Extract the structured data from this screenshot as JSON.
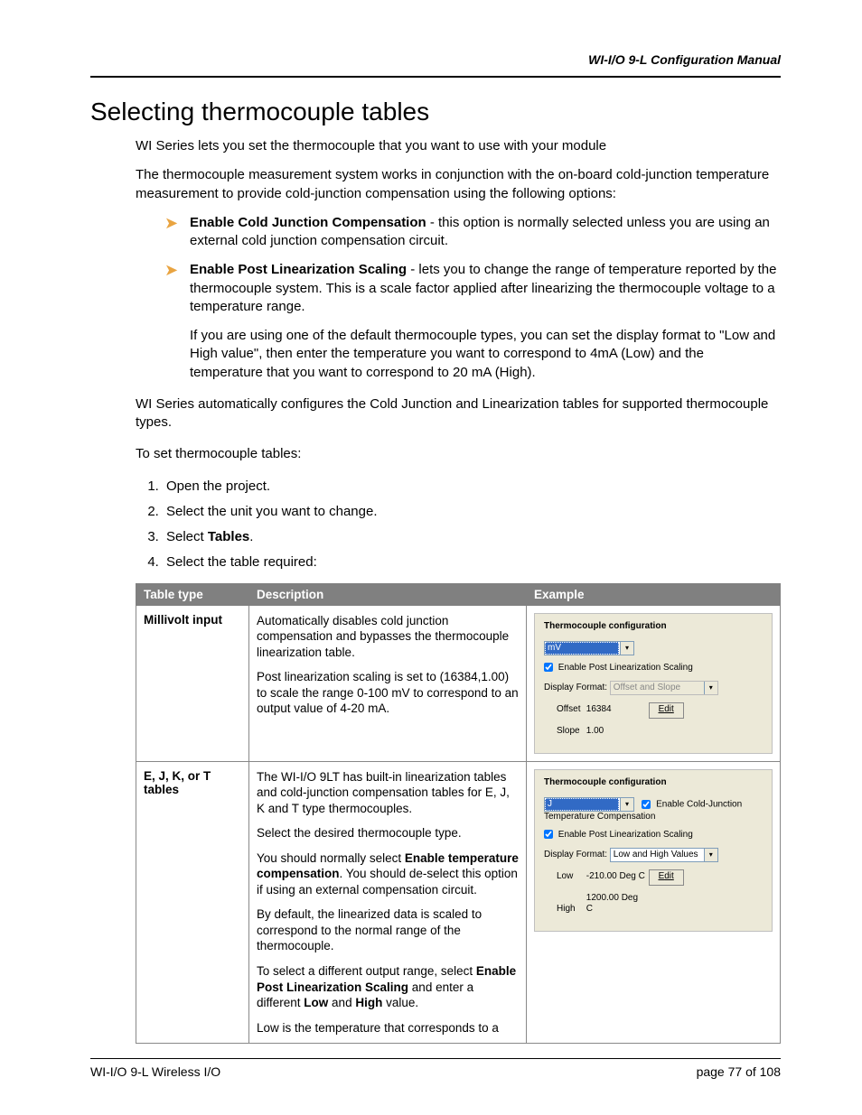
{
  "header": {
    "running": "WI-I/O 9-L Configuration Manual"
  },
  "title": "Selecting thermocouple tables",
  "intro": {
    "p1": "WI Series lets you set the thermocouple that you want to use with your module",
    "p2": "The thermocouple measurement system works in conjunction with the on-board cold-junction temperature measurement to provide cold-junction compensation using the following options:"
  },
  "bullets": {
    "b1_bold": "Enable Cold Junction Compensation",
    "b1_rest": " - this option is normally selected unless you are using an external cold junction compensation circuit.",
    "b2_bold": "Enable Post Linearization Scaling",
    "b2_rest": " - lets you to change the range of temperature reported by the thermocouple system. This is a scale factor applied after linearizing the thermocouple voltage to a temperature range.",
    "b2_p2": "If you are using one of the default thermocouple types, you can set the display format to \"Low and High value\", then enter the temperature you want to correspond to 4mA (Low) and the temperature that you want to correspond to 20 mA (High)."
  },
  "after": {
    "p1": "WI Series automatically configures the Cold Junction and Linearization tables for supported thermocouple types.",
    "p2": "To set thermocouple tables:"
  },
  "steps": {
    "s1": "Open the project.",
    "s2": "Select the unit you want to change.",
    "s3a": "Select ",
    "s3b": "Tables",
    "s3c": ".",
    "s4": "Select the table required:"
  },
  "table": {
    "h1": "Table type",
    "h2": "Description",
    "h3": "Example",
    "r1": {
      "type": "Millivolt input",
      "d1": "Automatically disables cold junction compensation and bypasses the thermocouple linearization table.",
      "d2": "Post linearization scaling is set to (16384,1.00) to scale the range 0-100 mV to correspond to an output value of 4-20 mA."
    },
    "r2": {
      "type": "E, J, K, or T tables",
      "d1": "The WI-I/O 9LT has built-in linearization tables and cold-junction compensation tables for E, J, K and T type thermocouples.",
      "d2": "Select the desired thermocouple type.",
      "d3a": "You should normally select ",
      "d3b": "Enable temperature compensation",
      "d3c": ". You should de-select this option if using an external compensation circuit.",
      "d4": "By default, the linearized data is scaled to correspond to the normal range of the thermocouple.",
      "d5a": "To select a different output range, select ",
      "d5b": "Enable Post Linearization Scaling",
      "d5c": " and enter a different ",
      "d5d": "Low",
      "d5e": " and ",
      "d5f": "High",
      "d5g": " value.",
      "d6": "Low is the temperature that corresponds to a"
    }
  },
  "ex1": {
    "title": "Thermocouple configuration",
    "combo": "mV",
    "cb1": "Enable Post Linearization Scaling",
    "dfmt_lbl": "Display Format:",
    "dfmt_val": "Offset and Slope",
    "offset_lbl": "Offset",
    "offset_val": "16384",
    "slope_lbl": "Slope",
    "slope_val": "1.00",
    "edit": "Edit"
  },
  "ex2": {
    "title": "Thermocouple configuration",
    "combo": "J",
    "cb0": "Enable Cold-Junction Temperature Compensation",
    "cb1": "Enable Post Linearization Scaling",
    "dfmt_lbl": "Display Format:",
    "dfmt_val": "Low and High Values",
    "low_lbl": "Low",
    "low_val": "-210.00 Deg C",
    "high_lbl": "High",
    "high_val": "1200.00 Deg C",
    "edit": "Edit"
  },
  "footer": {
    "left": "WI-I/O 9-L Wireless I/O",
    "right_a": "page  ",
    "right_b": "77 of 108"
  }
}
